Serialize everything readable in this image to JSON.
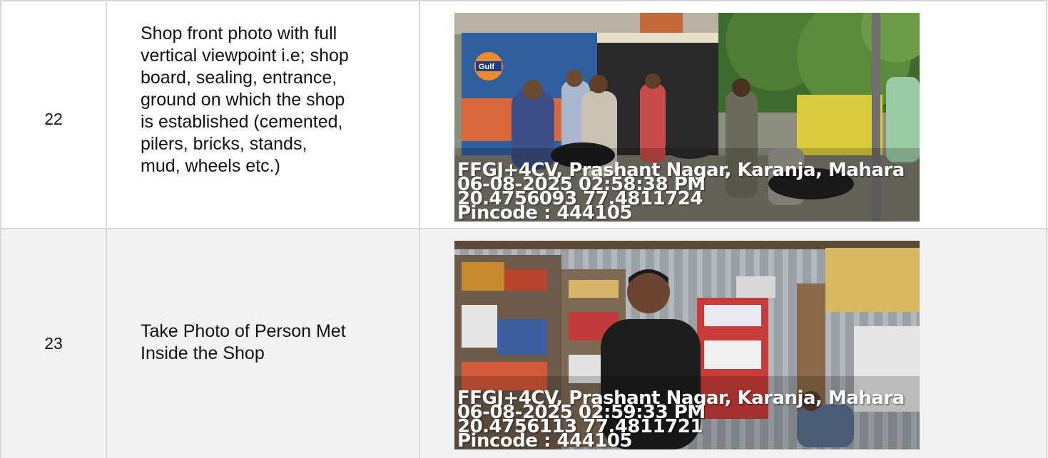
{
  "rows": [
    {
      "number": "22",
      "description_lines": [
        "Shop front photo with full",
        "vertical viewpoint i.e; shop",
        "board, sealing, entrance,",
        "ground on which the shop",
        "is established (cemented,",
        "pilers, bricks, stands,",
        "mud, wheels etc.)"
      ],
      "photo": {
        "subject": "shop front with people outside",
        "sign_text": "Gulf",
        "stamp": {
          "location": "FFGJ+4CV, Prashant Nagar, Karanja, Mahara",
          "datetime": "06-08-2025 02:58:38 PM",
          "coords": "20.4756093 77.4811724",
          "pincode": "Pincode : 444105"
        }
      }
    },
    {
      "number": "23",
      "description_lines": [
        "Take Photo of Person Met",
        "Inside the Shop"
      ],
      "photo": {
        "subject": "person standing inside auto parts shop",
        "stamp": {
          "location": "FFGJ+4CV, Prashant Nagar, Karanja, Mahara",
          "datetime": "06-08-2025 02:59:33 PM",
          "coords": "20.4756113 77.4811721",
          "pincode": "Pincode : 444105"
        }
      }
    }
  ]
}
